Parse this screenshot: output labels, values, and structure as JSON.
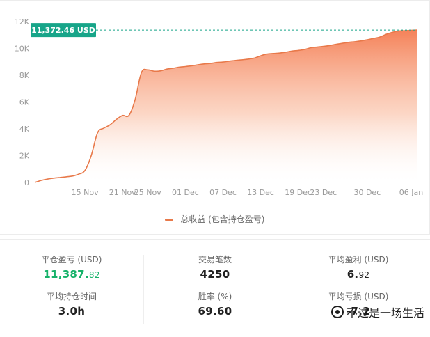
{
  "chart_data": {
    "type": "area",
    "series": [
      {
        "name": "总收益 (包含持仓盈亏)",
        "color": "#e8794a"
      }
    ],
    "x": [
      "11-07",
      "11-08",
      "11-09",
      "11-10",
      "11-11",
      "11-12",
      "11-13",
      "11-14",
      "11-15",
      "11-16",
      "11-17",
      "11-18",
      "11-19",
      "11-20",
      "11-21",
      "11-22",
      "11-23",
      "11-24",
      "11-25",
      "11-26",
      "11-27",
      "11-28",
      "11-29",
      "11-30",
      "12-01",
      "12-02",
      "12-03",
      "12-04",
      "12-05",
      "12-06",
      "12-07",
      "12-08",
      "12-09",
      "12-10",
      "12-11",
      "12-12",
      "12-13",
      "12-14",
      "12-15",
      "12-16",
      "12-17",
      "12-18",
      "12-19",
      "12-20",
      "12-21",
      "12-22",
      "12-23",
      "12-24",
      "12-25",
      "12-26",
      "12-27",
      "12-28",
      "12-29",
      "12-30",
      "12-31",
      "01-01",
      "01-02",
      "01-03",
      "01-04",
      "01-05",
      "01-06",
      "01-07"
    ],
    "values": [
      0,
      150,
      250,
      320,
      370,
      420,
      480,
      620,
      900,
      2000,
      3700,
      4050,
      4300,
      4700,
      5000,
      5000,
      6200,
      8200,
      8400,
      8300,
      8320,
      8450,
      8520,
      8600,
      8650,
      8700,
      8780,
      8840,
      8880,
      8950,
      8980,
      9050,
      9100,
      9150,
      9200,
      9280,
      9450,
      9580,
      9620,
      9650,
      9720,
      9800,
      9850,
      9920,
      10050,
      10100,
      10150,
      10220,
      10300,
      10380,
      10450,
      10500,
      10560,
      10650,
      10750,
      10850,
      11050,
      11200,
      11300,
      11320,
      11350,
      11372.46
    ],
    "x_ticks": [
      "15 Nov",
      "21 Nov",
      "25 Nov",
      "01 Dec",
      "07 Dec",
      "13 Dec",
      "19 Dec",
      "23 Dec",
      "30 Dec",
      "06 Jan"
    ],
    "x_tick_index": [
      8,
      14,
      18,
      24,
      30,
      36,
      42,
      46,
      53,
      60
    ],
    "y_ticks": [
      "0",
      "2K",
      "4K",
      "6K",
      "8K",
      "10K",
      "12K"
    ],
    "ylim": [
      0,
      12000
    ],
    "current_value_label": "11,372.46 USD",
    "current_value": 11372.46,
    "legend_position": "bottom-center",
    "grid": false
  },
  "legend": {
    "label": "总收益 (包含持仓盈亏)"
  },
  "stats": {
    "closed_pnl": {
      "label": "平仓盈亏 (USD)",
      "int_part": "11,387.",
      "dec_part": "82"
    },
    "avg_hold_time": {
      "label": "平均持仓时间",
      "value": "3.0h"
    },
    "trade_count": {
      "label": "交易笔数",
      "value": "4250"
    },
    "win_rate": {
      "label": "胜率 (%)",
      "value": "69.60"
    },
    "avg_profit": {
      "label": "平均盈利 (USD)",
      "int_part": "6.",
      "dec_part": "92"
    },
    "avg_loss": {
      "label": "平均亏损 (USD)",
      "value": "-7.2"
    }
  },
  "watermark": {
    "text": "不过是一场生活"
  },
  "colors": {
    "line": "#e8794a",
    "fill_top": "#f47b50",
    "badge": "#17a589",
    "green_text": "#17b26a"
  }
}
